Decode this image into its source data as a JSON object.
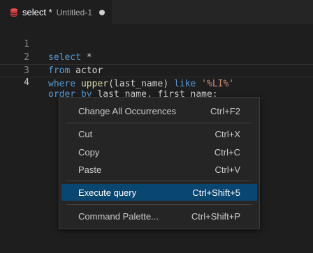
{
  "tab": {
    "title": "select *",
    "description": "Untitled-1",
    "icon": "database-icon"
  },
  "editor": {
    "lines": [
      {
        "number": "1",
        "tokens": [
          {
            "t": "select",
            "c": "kw"
          },
          {
            "t": " *",
            "c": ""
          }
        ]
      },
      {
        "number": "2",
        "tokens": [
          {
            "t": "from",
            "c": "kw"
          },
          {
            "t": " actor",
            "c": ""
          }
        ]
      },
      {
        "number": "3",
        "tokens": [
          {
            "t": "where",
            "c": "kw"
          },
          {
            "t": " ",
            "c": ""
          },
          {
            "t": "upper",
            "c": "fn"
          },
          {
            "t": "(last_name) ",
            "c": ""
          },
          {
            "t": "like",
            "c": "kw"
          },
          {
            "t": " ",
            "c": ""
          },
          {
            "t": "'%LI%'",
            "c": "str"
          }
        ]
      },
      {
        "number": "4",
        "tokens": [
          {
            "t": "order by",
            "c": "kw"
          },
          {
            "t": " last_name, first_name;",
            "c": ""
          }
        ]
      }
    ]
  },
  "context_menu": {
    "groups": [
      [
        {
          "label": "Change All Occurrences",
          "shortcut": "Ctrl+F2",
          "active": false
        }
      ],
      [
        {
          "label": "Cut",
          "shortcut": "Ctrl+X",
          "active": false
        },
        {
          "label": "Copy",
          "shortcut": "Ctrl+C",
          "active": false
        },
        {
          "label": "Paste",
          "shortcut": "Ctrl+V",
          "active": false
        }
      ],
      [
        {
          "label": "Execute query",
          "shortcut": "Ctrl+Shift+5",
          "active": true
        }
      ],
      [
        {
          "label": "Command Palette...",
          "shortcut": "Ctrl+Shift+P",
          "active": false
        }
      ]
    ]
  },
  "colors": {
    "keyword": "#569cd6",
    "function": "#dcdcaa",
    "string": "#ce9178",
    "menu_highlight": "#094771",
    "db_icon": "#f14c4c"
  }
}
